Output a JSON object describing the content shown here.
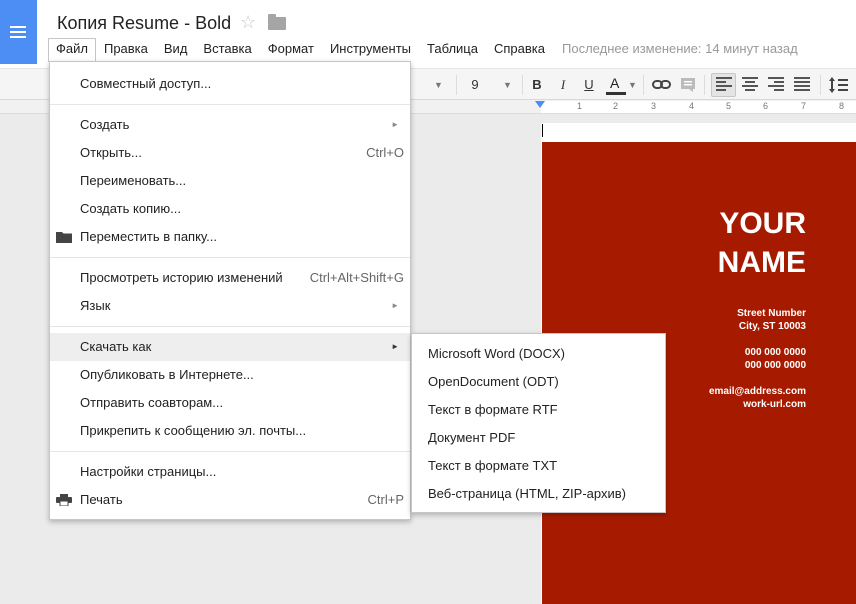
{
  "app": {
    "doc_title": "Копия Resume - Bold",
    "last_edit": "Последнее изменение: 14 минут назад"
  },
  "menubar": [
    {
      "label": "Файл"
    },
    {
      "label": "Правка"
    },
    {
      "label": "Вид"
    },
    {
      "label": "Вставка"
    },
    {
      "label": "Формат"
    },
    {
      "label": "Инструменты"
    },
    {
      "label": "Таблица"
    },
    {
      "label": "Справка"
    }
  ],
  "toolbar": {
    "font_size": "9",
    "bold": "B",
    "italic": "I",
    "underline": "U",
    "text_color": "A"
  },
  "ruler": {
    "ticks": [
      "1",
      "2",
      "3",
      "4",
      "5",
      "6",
      "7",
      "8"
    ]
  },
  "file_menu": {
    "share": "Совместный доступ...",
    "new": "Создать",
    "open": "Открыть...",
    "open_shortcut": "Ctrl+O",
    "rename": "Переименовать...",
    "make_copy": "Создать копию...",
    "move_to_folder": "Переместить в папку...",
    "revision_history": "Просмотреть историю изменений",
    "revision_history_shortcut": "Ctrl+Alt+Shift+G",
    "language": "Язык",
    "download_as": "Скачать как",
    "publish": "Опубликовать в Интернете...",
    "email_collaborators": "Отправить соавторам...",
    "email_attachment": "Прикрепить к сообщению эл. почты...",
    "page_setup": "Настройки страницы...",
    "print": "Печать",
    "print_shortcut": "Ctrl+P"
  },
  "download_submenu": [
    {
      "label": "Microsoft Word (DOCX)"
    },
    {
      "label": "OpenDocument (ODT)"
    },
    {
      "label": "Текст в формате RTF"
    },
    {
      "label": "Документ PDF"
    },
    {
      "label": "Текст в формате TXT"
    },
    {
      "label": "Веб-страница (HTML, ZIP-архив)"
    }
  ],
  "resume": {
    "name_line1": "YOUR",
    "name_line2": "NAME",
    "street": "Street Number",
    "city": "City, ST 10003",
    "phone1": "000 000 0000",
    "phone2": "000 000 0000",
    "email": "email@address.com",
    "url": "work-url.com"
  },
  "colors": {
    "brand_blue": "#4d8ef5",
    "resume_red": "#a61b00"
  },
  "icons": [
    "docs-logo-icon",
    "star-icon",
    "folder-icon",
    "print-icon",
    "link-icon",
    "comment-icon",
    "line-spacing-icon"
  ]
}
